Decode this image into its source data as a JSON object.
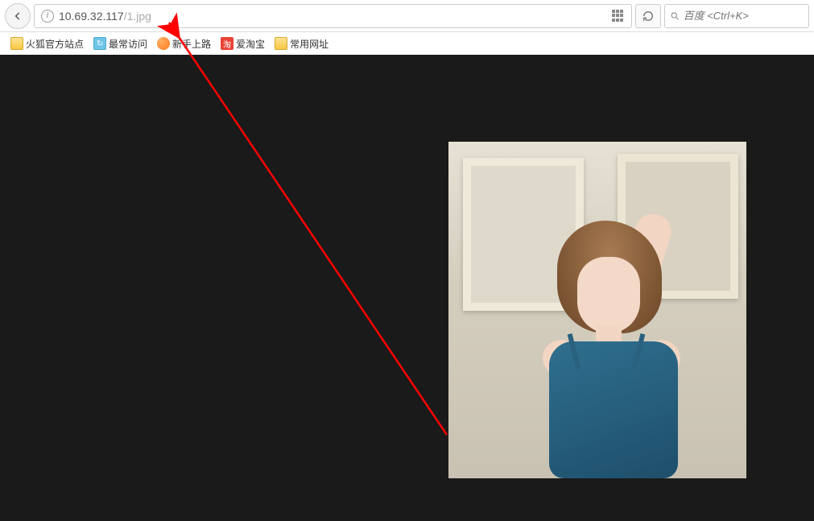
{
  "url": {
    "host": "10.69.32.117",
    "path": "/1.jpg"
  },
  "search": {
    "placeholder": "百度 <Ctrl+K>"
  },
  "bookmarks": {
    "item1": "火狐官方站点",
    "item2": "最常访问",
    "item3": "新手上路",
    "item4_icon": "淘",
    "item4": "爱淘宝",
    "item5": "常用网址"
  }
}
